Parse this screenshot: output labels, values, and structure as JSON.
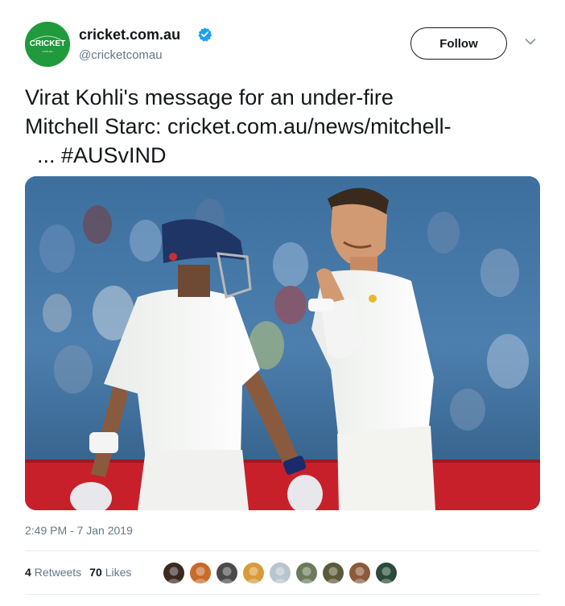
{
  "account": {
    "display_name": "cricket.com.au",
    "handle": "@cricketcomau",
    "avatar_text": "CRICKET",
    "avatar_subtext": "com.au",
    "avatar_color": "#1f9a3c",
    "verified_color": "#1da1f2"
  },
  "header": {
    "follow_label": "Follow",
    "menu_icon": "chevron-down-icon"
  },
  "tweet": {
    "lines": [
      "Virat Kohli's message for an under-fire",
      "Mitchell Starc: cricket.com.au/news/mitchell-",
      "... #AUSvIND"
    ]
  },
  "media": {
    "description_icon": "photo"
  },
  "meta": {
    "timestamp": "2:49 PM - 7 Jan 2019"
  },
  "stats": {
    "retweets_count": "4",
    "retweets_label": "Retweets",
    "likes_count": "70",
    "likes_label": "Likes"
  },
  "likers": [
    {
      "color": "#3a2a22"
    },
    {
      "color": "#c86a2a"
    },
    {
      "color": "#4a4a4a"
    },
    {
      "color": "#d89a3a"
    },
    {
      "color": "#b8c4ce"
    },
    {
      "color": "#6a7a5a"
    },
    {
      "color": "#5a5a3a"
    },
    {
      "color": "#8a5a3a"
    },
    {
      "color": "#2a4a3a"
    }
  ]
}
